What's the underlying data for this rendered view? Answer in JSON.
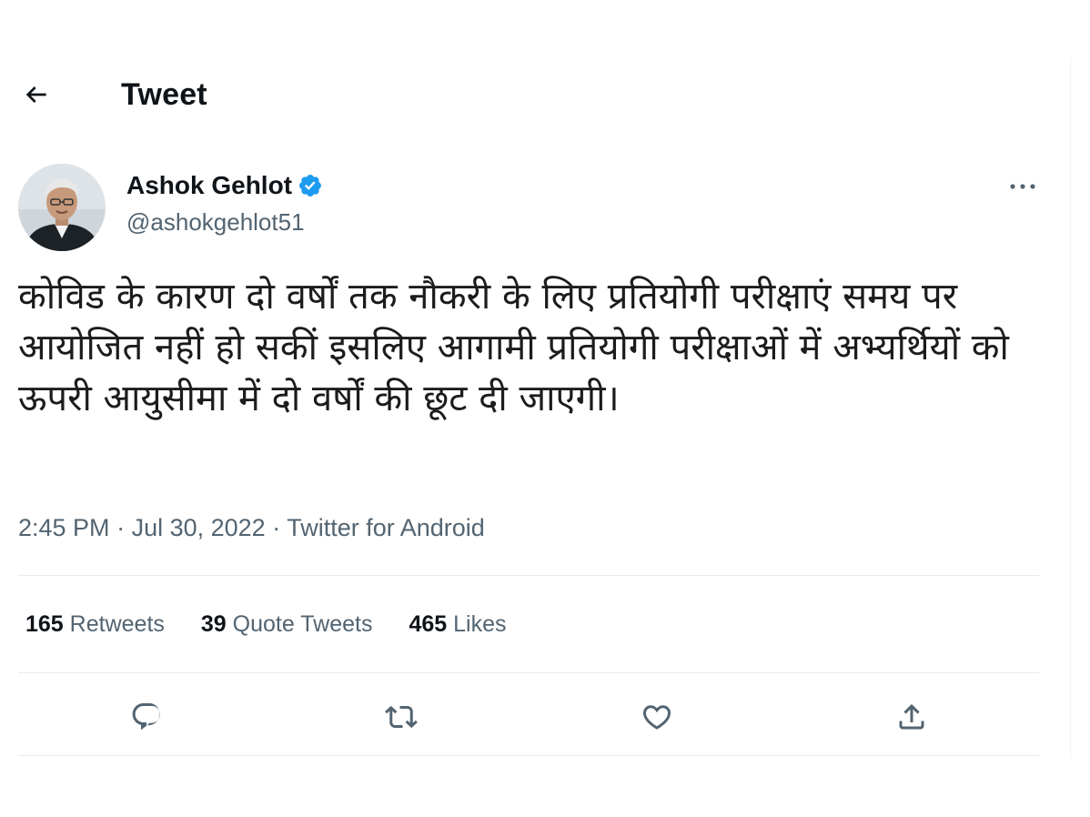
{
  "header": {
    "title": "Tweet",
    "back_icon": "arrow-left-icon"
  },
  "author": {
    "name": "Ashok Gehlot",
    "handle": "@ashokgehlot51",
    "verified": true,
    "verified_color": "#1d9bf0"
  },
  "tweet": {
    "text": "कोविड के कारण दो वर्षों तक नौकरी के लिए प्रतियोगी परीक्षाएं समय पर आयोजित नहीं हो सकीं इसलिए आगामी प्रतियोगी परीक्षाओं में अभ्यर्थियों को ऊपरी आयुसीमा में दो वर्षों की छूट दी जाएगी।",
    "time": "2:45 PM",
    "separator": " · ",
    "date": "Jul 30, 2022",
    "source": "Twitter for Android"
  },
  "stats": {
    "retweets_count": "165",
    "retweets_label": "Retweets",
    "quotes_count": "39",
    "quotes_label": "Quote Tweets",
    "likes_count": "465",
    "likes_label": "Likes"
  },
  "actions": [
    "reply-icon",
    "retweet-icon",
    "like-icon",
    "share-icon"
  ],
  "colors": {
    "text": "#0f1419",
    "secondary": "#536471",
    "border": "#eff3f4",
    "accent": "#1d9bf0"
  }
}
